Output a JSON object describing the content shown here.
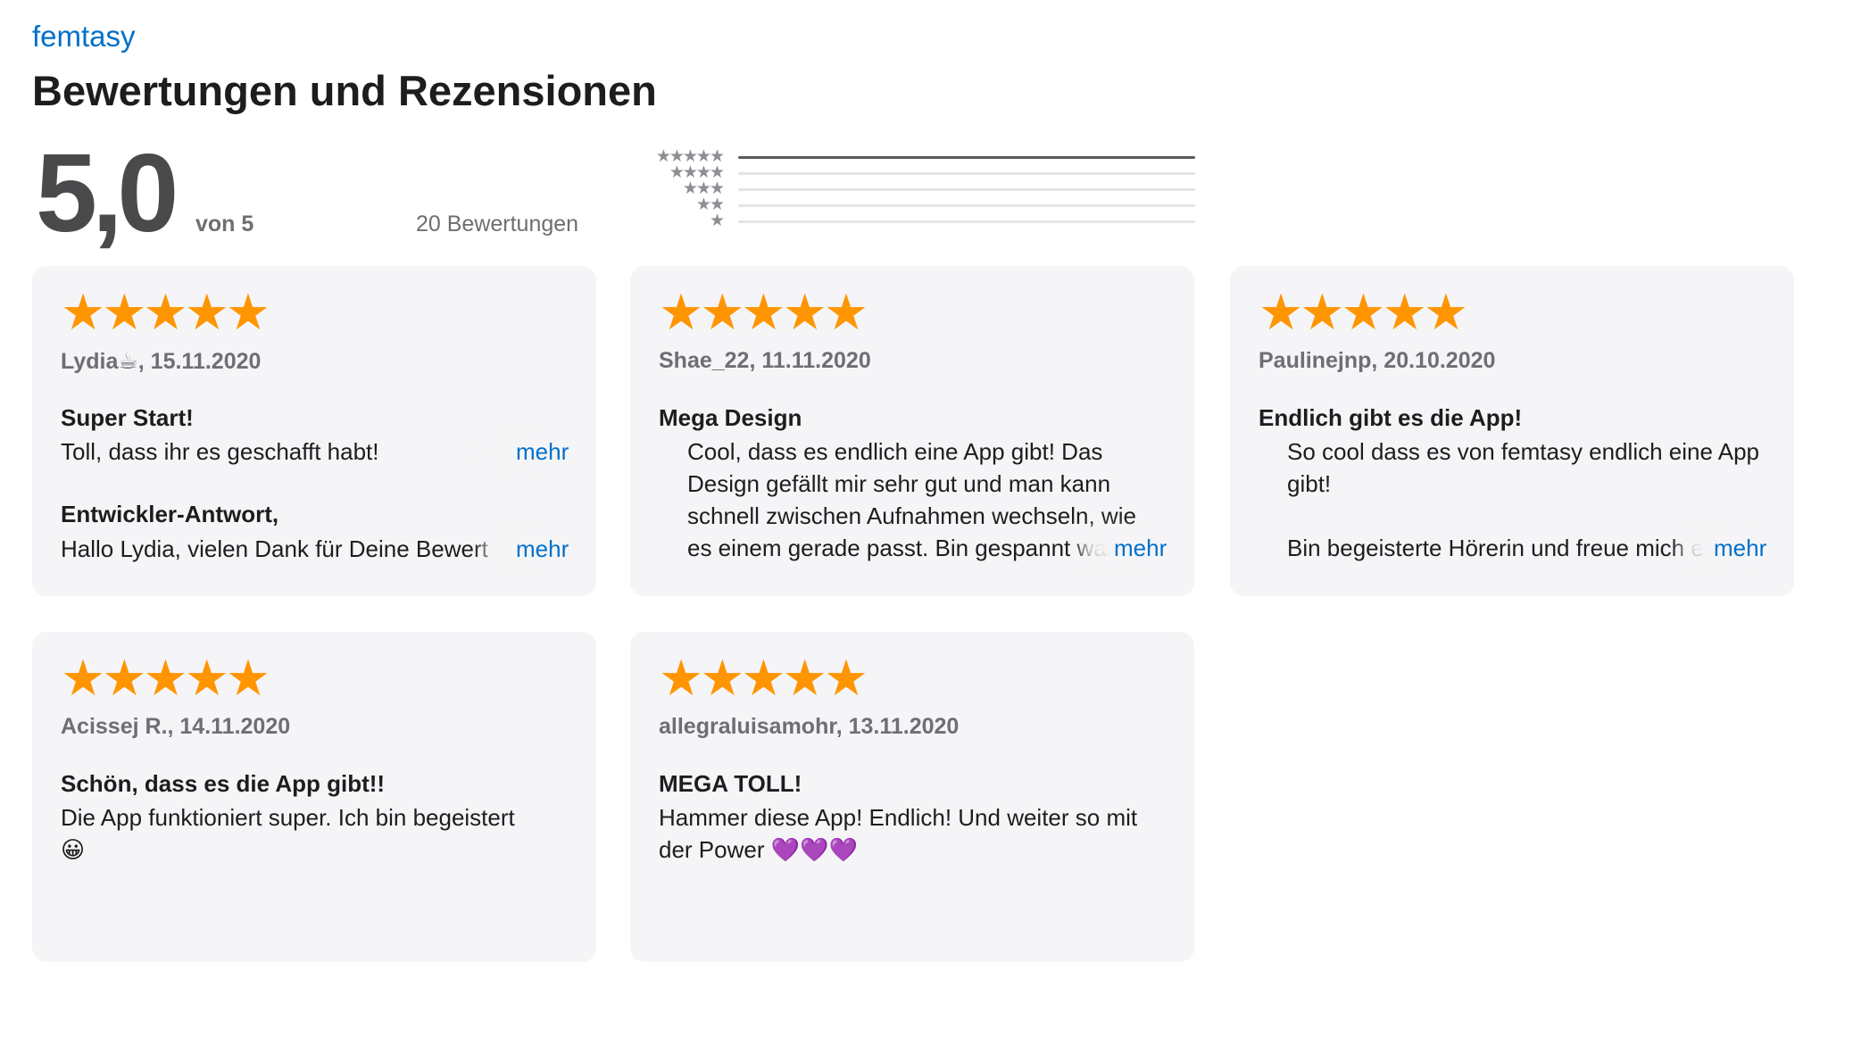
{
  "app": {
    "name": "femtasy"
  },
  "page_title": "Bewertungen und Rezensionen",
  "summary": {
    "score": "5,0",
    "out_of": "von 5",
    "count": "20 Bewertungen"
  },
  "histogram": [
    {
      "stars": "★★★★★",
      "fraction": 1.0
    },
    {
      "stars": "★★★★",
      "fraction": 0.0
    },
    {
      "stars": "★★★",
      "fraction": 0.0
    },
    {
      "stars": "★★",
      "fraction": 0.0
    },
    {
      "stars": "★",
      "fraction": 0.0
    }
  ],
  "more_label": "mehr",
  "reviews": [
    {
      "stars": "★★★★★",
      "rating": 5,
      "meta": "Lydia☕, 15.11.2020",
      "title": "Super Start!",
      "body": "Toll, dass ihr es geschafft habt!",
      "developer_response_title": "Entwickler-Antwort,",
      "developer_response": "Hallo Lydia, vielen Dank für Deine Bewert"
    },
    {
      "stars": "★★★★★",
      "rating": 5,
      "meta": "Shae_22, 11.11.2020",
      "title": "Mega Design",
      "body": "Cool, dass es endlich eine App gibt! Das\nDesign gefällt mir sehr gut und man kann\nschnell zwischen Aufnahmen wechseln, wie\nes einem gerade passt. Bin gespannt was"
    },
    {
      "stars": "★★★★★",
      "rating": 5,
      "meta": "Paulinejnp, 20.10.2020",
      "title": "Endlich gibt es die App!",
      "body": "So cool dass es von femtasy endlich eine App\ngibt!\n\nBin begeisterte Hörerin und freue mich e"
    },
    {
      "stars": "★★★★★",
      "rating": 5,
      "meta": "Acissej R., 14.11.2020",
      "title": "Schön, dass es die App gibt!!",
      "body": "Die App funktioniert super. Ich bin begeistert\n😀"
    },
    {
      "stars": "★★★★★",
      "rating": 5,
      "meta": "allegraluisamohr, 13.11.2020",
      "title": "MEGA TOLL!",
      "body": "Hammer diese App! Endlich! Und weiter so mit\nder Power 💜💜💜"
    }
  ],
  "colors": {
    "link": "#0070c9",
    "star": "#ff9500",
    "card_bg": "#f5f5f7",
    "score": "#4a4a4d"
  }
}
